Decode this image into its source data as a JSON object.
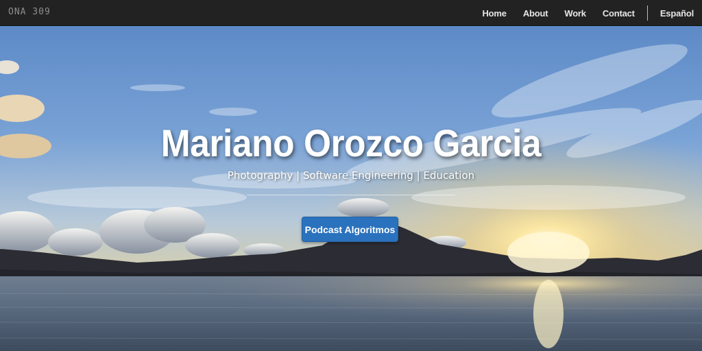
{
  "navbar": {
    "brand": "ONA 309",
    "links": [
      "Home",
      "About",
      "Work",
      "Contact"
    ],
    "language": "Español"
  },
  "hero": {
    "title": "Mariano Orozco Garcia",
    "subtitle": "Photography | Software Engineering | Education",
    "cta_label": "Podcast Algoritmos"
  },
  "colors": {
    "navbar_bg": "#222222",
    "cta_bg": "#2b72be",
    "text": "#ffffff"
  }
}
